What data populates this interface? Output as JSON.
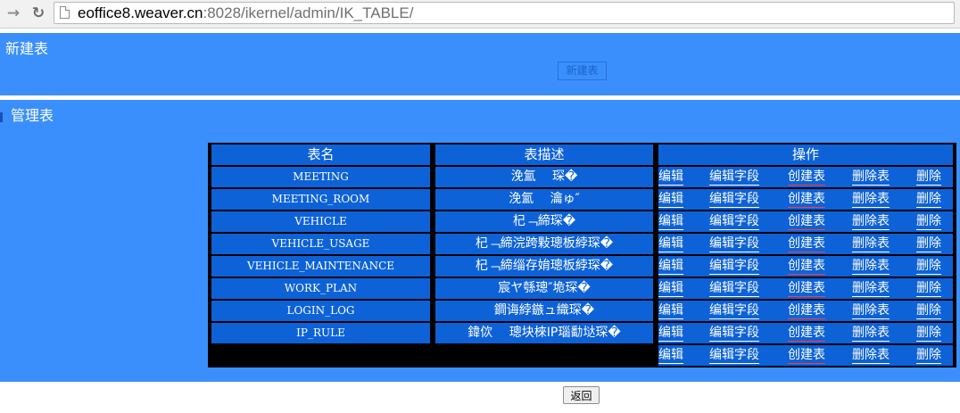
{
  "browser": {
    "url_host": "eoffice8.weaver.cn",
    "url_rest": ":8028/ikernel/admin/IK_TABLE/"
  },
  "new_table_section": {
    "title": "新建表",
    "button_label": "新建表"
  },
  "manage_section": {
    "title": "管理表"
  },
  "table": {
    "headers": [
      "表名",
      "表描述",
      "操作"
    ],
    "rows": [
      {
        "name": "MEETING",
        "desc": "浼氳　 琛�"
      },
      {
        "name": "MEETING_ROOM",
        "desc": "浼氳　 瀹ゅ″"
      },
      {
        "name": "VEHICLE",
        "desc": "杞﹁締琛�"
      },
      {
        "name": "VEHICLE_USAGE",
        "desc": "杞﹁締浣跨敤璁板綍琛�"
      },
      {
        "name": "VEHICLE_MAINTENANCE",
        "desc": "杞﹁締缁存姢璁板綍琛�"
      },
      {
        "name": "WORK_PLAN",
        "desc": "宸ヤ綔璁″垝琛�"
      },
      {
        "name": "LOGIN_LOG",
        "desc": "鐧诲綍鏃ュ織琛�"
      },
      {
        "name": "IP_RULE",
        "desc": "鍏佽　 璁块棶IP瑙勫垯琛�"
      }
    ],
    "op_labels": [
      "编辑",
      "编辑字段",
      "创建表",
      "删除表",
      "删除"
    ]
  },
  "return_button": "返回",
  "colors": {
    "panel_blue": "#3a8ffd",
    "cell_blue": "#0d62d8",
    "grid_black": "#000000"
  }
}
